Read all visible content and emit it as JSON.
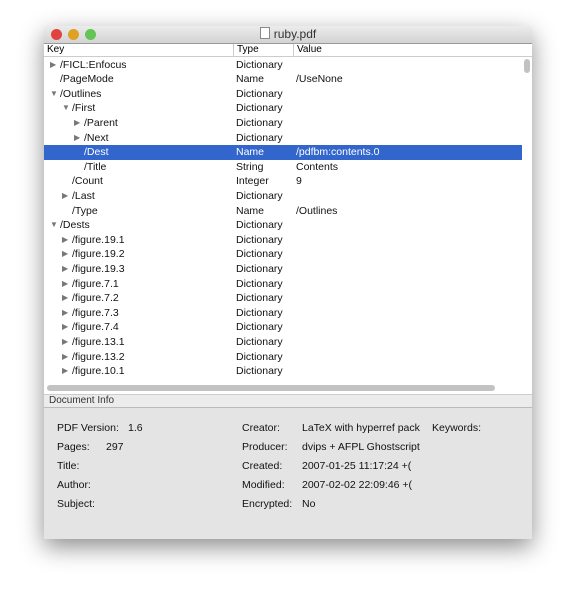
{
  "window": {
    "title": "ruby.pdf",
    "title_icon": "pdf-file-icon"
  },
  "columns": {
    "key": "Key",
    "type": "Type",
    "value": "Value"
  },
  "rows": [
    {
      "key": "/FICL:Enfocus",
      "type": "Dictionary",
      "value": "",
      "level": 0,
      "disclosure": "collapsed"
    },
    {
      "key": "/PageMode",
      "type": "Name",
      "value": "/UseNone",
      "level": 0,
      "disclosure": "none"
    },
    {
      "key": "/Outlines",
      "type": "Dictionary",
      "value": "",
      "level": 0,
      "disclosure": "expanded"
    },
    {
      "key": "/First",
      "type": "Dictionary",
      "value": "",
      "level": 1,
      "disclosure": "expanded"
    },
    {
      "key": "/Parent",
      "type": "Dictionary",
      "value": "",
      "level": 2,
      "disclosure": "collapsed"
    },
    {
      "key": "/Next",
      "type": "Dictionary",
      "value": "",
      "level": 2,
      "disclosure": "collapsed"
    },
    {
      "key": "/Dest",
      "type": "Name",
      "value": "/pdfbm:contents.0",
      "level": 2,
      "disclosure": "none",
      "selected": true
    },
    {
      "key": "/Title",
      "type": "String",
      "value": "Contents",
      "level": 2,
      "disclosure": "none"
    },
    {
      "key": "/Count",
      "type": "Integer",
      "value": "9",
      "level": 1,
      "disclosure": "none"
    },
    {
      "key": "/Last",
      "type": "Dictionary",
      "value": "",
      "level": 1,
      "disclosure": "collapsed"
    },
    {
      "key": "/Type",
      "type": "Name",
      "value": "/Outlines",
      "level": 1,
      "disclosure": "none"
    },
    {
      "key": "/Dests",
      "type": "Dictionary",
      "value": "",
      "level": 0,
      "disclosure": "expanded"
    },
    {
      "key": "/figure.19.1",
      "type": "Dictionary",
      "value": "",
      "level": 1,
      "disclosure": "collapsed"
    },
    {
      "key": "/figure.19.2",
      "type": "Dictionary",
      "value": "",
      "level": 1,
      "disclosure": "collapsed"
    },
    {
      "key": "/figure.19.3",
      "type": "Dictionary",
      "value": "",
      "level": 1,
      "disclosure": "collapsed"
    },
    {
      "key": "/figure.7.1",
      "type": "Dictionary",
      "value": "",
      "level": 1,
      "disclosure": "collapsed"
    },
    {
      "key": "/figure.7.2",
      "type": "Dictionary",
      "value": "",
      "level": 1,
      "disclosure": "collapsed"
    },
    {
      "key": "/figure.7.3",
      "type": "Dictionary",
      "value": "",
      "level": 1,
      "disclosure": "collapsed"
    },
    {
      "key": "/figure.7.4",
      "type": "Dictionary",
      "value": "",
      "level": 1,
      "disclosure": "collapsed"
    },
    {
      "key": "/figure.13.1",
      "type": "Dictionary",
      "value": "",
      "level": 1,
      "disclosure": "collapsed"
    },
    {
      "key": "/figure.13.2",
      "type": "Dictionary",
      "value": "",
      "level": 1,
      "disclosure": "collapsed"
    },
    {
      "key": "/figure.10.1",
      "type": "Dictionary",
      "value": "",
      "level": 1,
      "disclosure": "collapsed"
    }
  ],
  "document_info": {
    "section_label": "Document Info",
    "pdf_version_label": "PDF Version:",
    "pdf_version": "1.6",
    "pages_label": "Pages:",
    "pages": "297",
    "title_label": "Title:",
    "author_label": "Author:",
    "subject_label": "Subject:",
    "creator_label": "Creator:",
    "creator": "LaTeX with hyperref pack",
    "producer_label": "Producer:",
    "producer": "dvips + AFPL Ghostscript",
    "created_label": "Created:",
    "created": "2007-01-25 11:17:24 +(",
    "modified_label": "Modified:",
    "modified": "2007-02-02 22:09:46 +(",
    "encrypted_label": "Encrypted:",
    "encrypted": "No",
    "keywords_label": "Keywords:"
  },
  "colors": {
    "selection": "#3366cc",
    "close": "#e0443e",
    "minimize": "#dea123",
    "zoom": "#62c554"
  }
}
